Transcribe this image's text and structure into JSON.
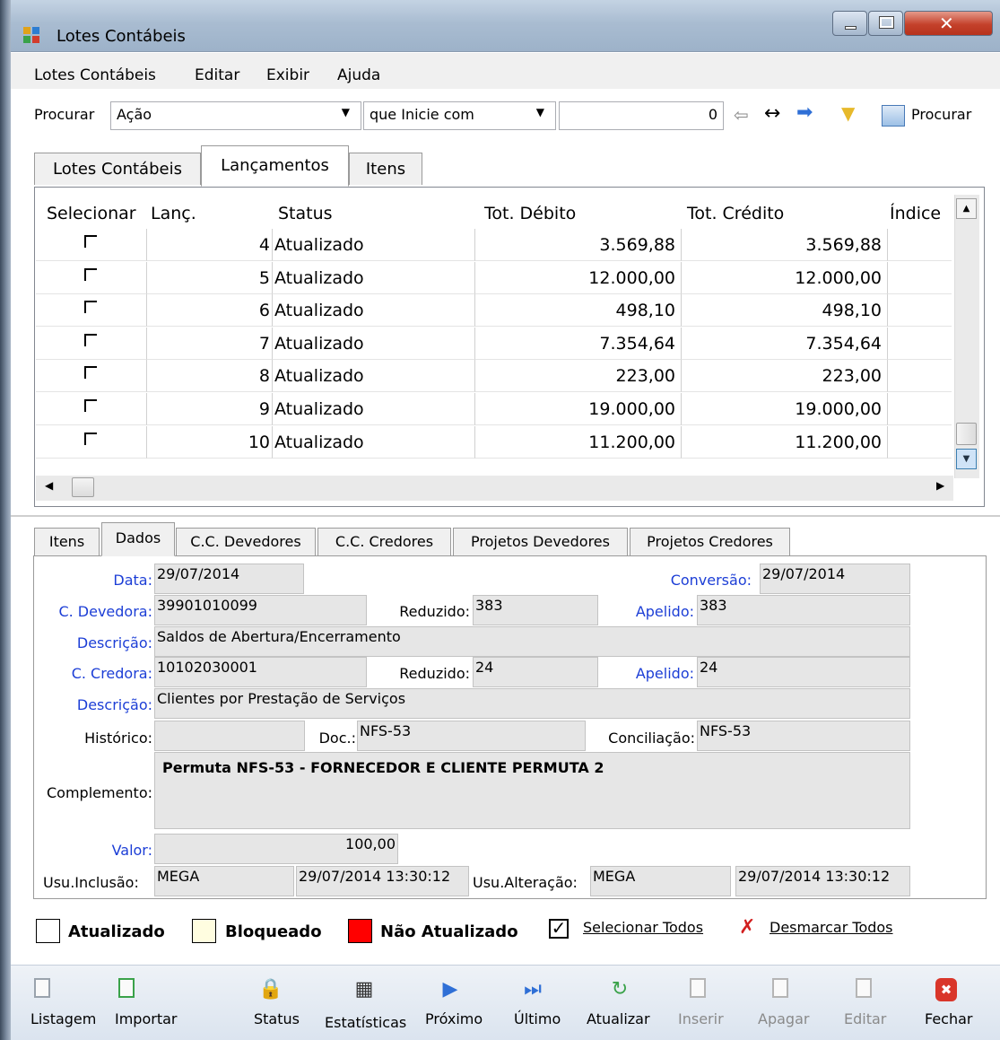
{
  "window": {
    "title": "Lotes Contábeis"
  },
  "menu": [
    "Lotes Contábeis",
    "Editar",
    "Exibir",
    "Ajuda"
  ],
  "search": {
    "label": "Procurar",
    "field": "Ação",
    "mode": "que Inicie com",
    "value": "0",
    "button": "Procurar"
  },
  "top_tabs": [
    "Lotes Contábeis",
    "Lançamentos",
    "Itens"
  ],
  "table": {
    "headers": [
      "Selecionar",
      "Lanç.",
      "Status",
      "Tot. Débito",
      "Tot. Crédito",
      "Índice"
    ],
    "rows": [
      {
        "lanc": "4",
        "status": "Atualizado",
        "debito": "3.569,88",
        "credito": "3.569,88"
      },
      {
        "lanc": "5",
        "status": "Atualizado",
        "debito": "12.000,00",
        "credito": "12.000,00"
      },
      {
        "lanc": "6",
        "status": "Atualizado",
        "debito": "498,10",
        "credito": "498,10"
      },
      {
        "lanc": "7",
        "status": "Atualizado",
        "debito": "7.354,64",
        "credito": "7.354,64"
      },
      {
        "lanc": "8",
        "status": "Atualizado",
        "debito": "223,00",
        "credito": "223,00"
      },
      {
        "lanc": "9",
        "status": "Atualizado",
        "debito": "19.000,00",
        "credito": "19.000,00"
      },
      {
        "lanc": "10",
        "status": "Atualizado",
        "debito": "11.200,00",
        "credito": "11.200,00"
      }
    ]
  },
  "bottom_tabs": [
    "Itens",
    "Dados",
    "C.C. Devedores",
    "C.C. Credores",
    "Projetos Devedores",
    "Projetos Credores"
  ],
  "form": {
    "data_label": "Data:",
    "data": "29/07/2014",
    "conversao_label": "Conversão:",
    "conversao": "29/07/2014",
    "cdev_label": "C. Devedora:",
    "cdev": "39901010099",
    "red1_label": "Reduzido:",
    "red1": "383",
    "ap1_label": "Apelido:",
    "ap1": "383",
    "desc1_label": "Descrição:",
    "desc1": "Saldos de Abertura/Encerramento",
    "ccred_label": "C. Credora:",
    "ccred": "10102030001",
    "red2_label": "Reduzido:",
    "red2": "24",
    "ap2_label": "Apelido:",
    "ap2": "24",
    "desc2_label": "Descrição:",
    "desc2": "Clientes por Prestação de Serviços",
    "hist_label": "Histórico:",
    "hist": "",
    "doc_label": "Doc.:",
    "doc": "NFS-53",
    "conc_label": "Conciliação:",
    "conc": "NFS-53",
    "comp_label": "Complemento:",
    "comp": "Permuta NFS-53 - FORNECEDOR E CLIENTE PERMUTA 2",
    "valor_label": "Valor:",
    "valor": "100,00",
    "usuinc_label": "Usu.Inclusão:",
    "usuinc": "MEGA",
    "usuinc_dt": "29/07/2014 13:30:12",
    "usualt_label": "Usu.Alteração:",
    "usualt": "MEGA",
    "usualt_dt": "29/07/2014 13:30:12"
  },
  "legend": {
    "atualizado": "Atualizado",
    "bloqueado": "Bloqueado",
    "nao_atualizado": "Não Atualizado",
    "sel_todos": "Selecionar Todos",
    "desm_todos": "Desmarcar Todos"
  },
  "toolbar": [
    "Listagem",
    "Importar",
    "Status",
    "Estatísticas",
    "Próximo",
    "Último",
    "Atualizar",
    "Inserir",
    "Apagar",
    "Editar",
    "Fechar"
  ],
  "colors": {
    "legend_bloqueado": "#fffde0",
    "legend_nao_atualizado": "#ff0000",
    "label_blue": "#1c3ed6"
  }
}
